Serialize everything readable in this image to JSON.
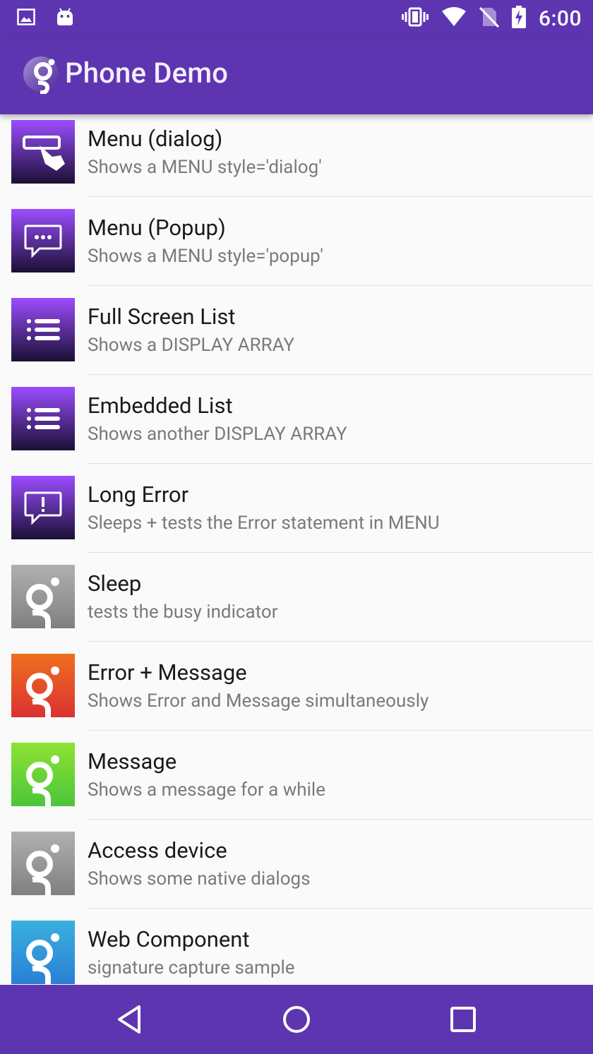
{
  "status_bar": {
    "time": "6:00",
    "left_icons": [
      "image-icon",
      "android-icon"
    ],
    "right_icons": [
      "vibrate-icon",
      "wifi-icon",
      "no-sim-icon",
      "battery-charging-icon"
    ]
  },
  "app_bar": {
    "title": "Phone Demo",
    "logo_icon": "genero-logo-icon",
    "color": "#5e35b1"
  },
  "items": [
    {
      "title": "Menu (dialog)",
      "subtitle": "Shows a MENU style='dialog'",
      "icon": "touch-menu-icon",
      "icon_style": "purple"
    },
    {
      "title": "Menu (Popup)",
      "subtitle": "Shows a MENU style='popup'",
      "icon": "chat-bubble-icon",
      "icon_style": "purple"
    },
    {
      "title": "Full Screen List",
      "subtitle": "Shows a DISPLAY ARRAY",
      "icon": "list-icon",
      "icon_style": "purple"
    },
    {
      "title": "Embedded List",
      "subtitle": "Shows another DISPLAY ARRAY",
      "icon": "list-icon",
      "icon_style": "purple"
    },
    {
      "title": "Long Error",
      "subtitle": "Sleeps + tests the Error statement in MENU",
      "icon": "alert-bubble-icon",
      "icon_style": "purple"
    },
    {
      "title": "Sleep",
      "subtitle": "tests the busy indicator",
      "icon": "genero-logo-icon",
      "icon_style": "gray"
    },
    {
      "title": "Error + Message",
      "subtitle": "Shows Error and Message simultaneously",
      "icon": "genero-logo-icon",
      "icon_style": "orange"
    },
    {
      "title": "Message",
      "subtitle": "Shows a message for a while",
      "icon": "genero-logo-icon",
      "icon_style": "green"
    },
    {
      "title": "Access device",
      "subtitle": "Shows some native dialogs",
      "icon": "genero-logo-icon",
      "icon_style": "gray"
    },
    {
      "title": "Web Component",
      "subtitle": "signature capture sample",
      "icon": "genero-logo-icon",
      "icon_style": "blue"
    }
  ],
  "nav_bar": {
    "buttons": [
      "back-icon",
      "home-icon",
      "recents-icon"
    ]
  },
  "colors": {
    "primary": "#5e35b1",
    "purple_icon_top": "#9c4dff",
    "purple_icon_bottom": "#1a1035",
    "gray_icon": "#8f8f8f",
    "orange_icon": "#e8572a",
    "green_icon": "#6fd232",
    "blue_icon": "#2f8fd6"
  }
}
